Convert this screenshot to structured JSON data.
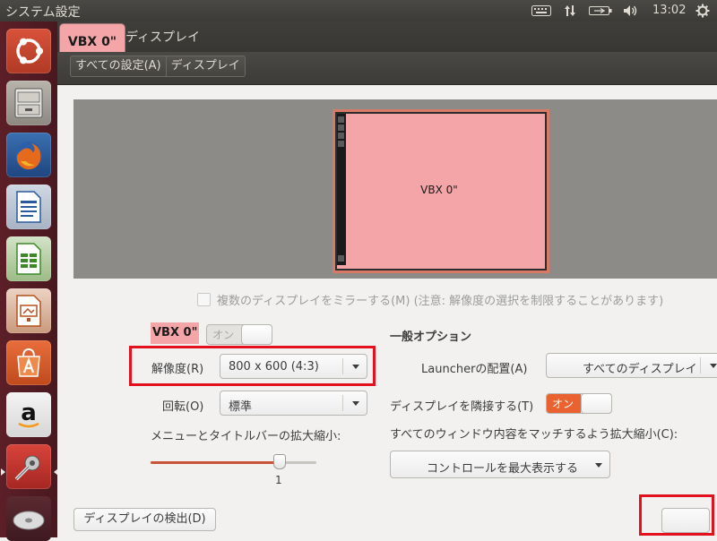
{
  "top_panel": {
    "app_title": "システム設定",
    "clock": "13:02"
  },
  "window": {
    "title": "ディスプレイ",
    "tooltip_label": "VBX 0\""
  },
  "breadcrumb": {
    "all_settings": "すべての設定(A)",
    "current": "ディスプレイ"
  },
  "preview": {
    "monitor_label": "VBX 0\""
  },
  "mirror": {
    "label": "複数のディスプレイをミラーする(M) (注意: 解像度の選択を制限することがあります)",
    "checked": false
  },
  "display": {
    "name": "VBX 0\"",
    "switch_label": "オン",
    "resolution_label": "解像度(R)",
    "resolution_value": "800 x 600 (4:3)",
    "rotation_label": "回転(O)",
    "rotation_value": "標準",
    "scale_label": "メニューとタイトルバーの拡大縮小:",
    "scale_value": "1",
    "scale_fraction": 0.77
  },
  "general": {
    "heading": "一般オプション",
    "launcher_label": "Launcherの配置(A)",
    "launcher_value": "すべてのディスプレイ",
    "adjacent_label": "ディスプレイを隣接する(T)",
    "adjacent_switch": "オン",
    "scale_all_label": "すべてのウィンドウ内容をマッチするよう拡大縮小(C):",
    "scale_all_value": "コントロールを最大表示する"
  },
  "footer": {
    "detect_button": "ディスプレイの検出(D)"
  },
  "colors": {
    "highlight_red": "#e3101d",
    "display_pink": "#f4a5a8",
    "switch_orange": "#e9622f",
    "launcher_bg": "#5c1f27"
  },
  "launcher_icons": [
    "ubuntu-dash-icon",
    "file-cabinet-icon",
    "firefox-icon",
    "writer-icon",
    "calc-icon",
    "impress-icon",
    "software-center-icon",
    "amazon-icon",
    "system-settings-icon",
    "disc-icon"
  ]
}
